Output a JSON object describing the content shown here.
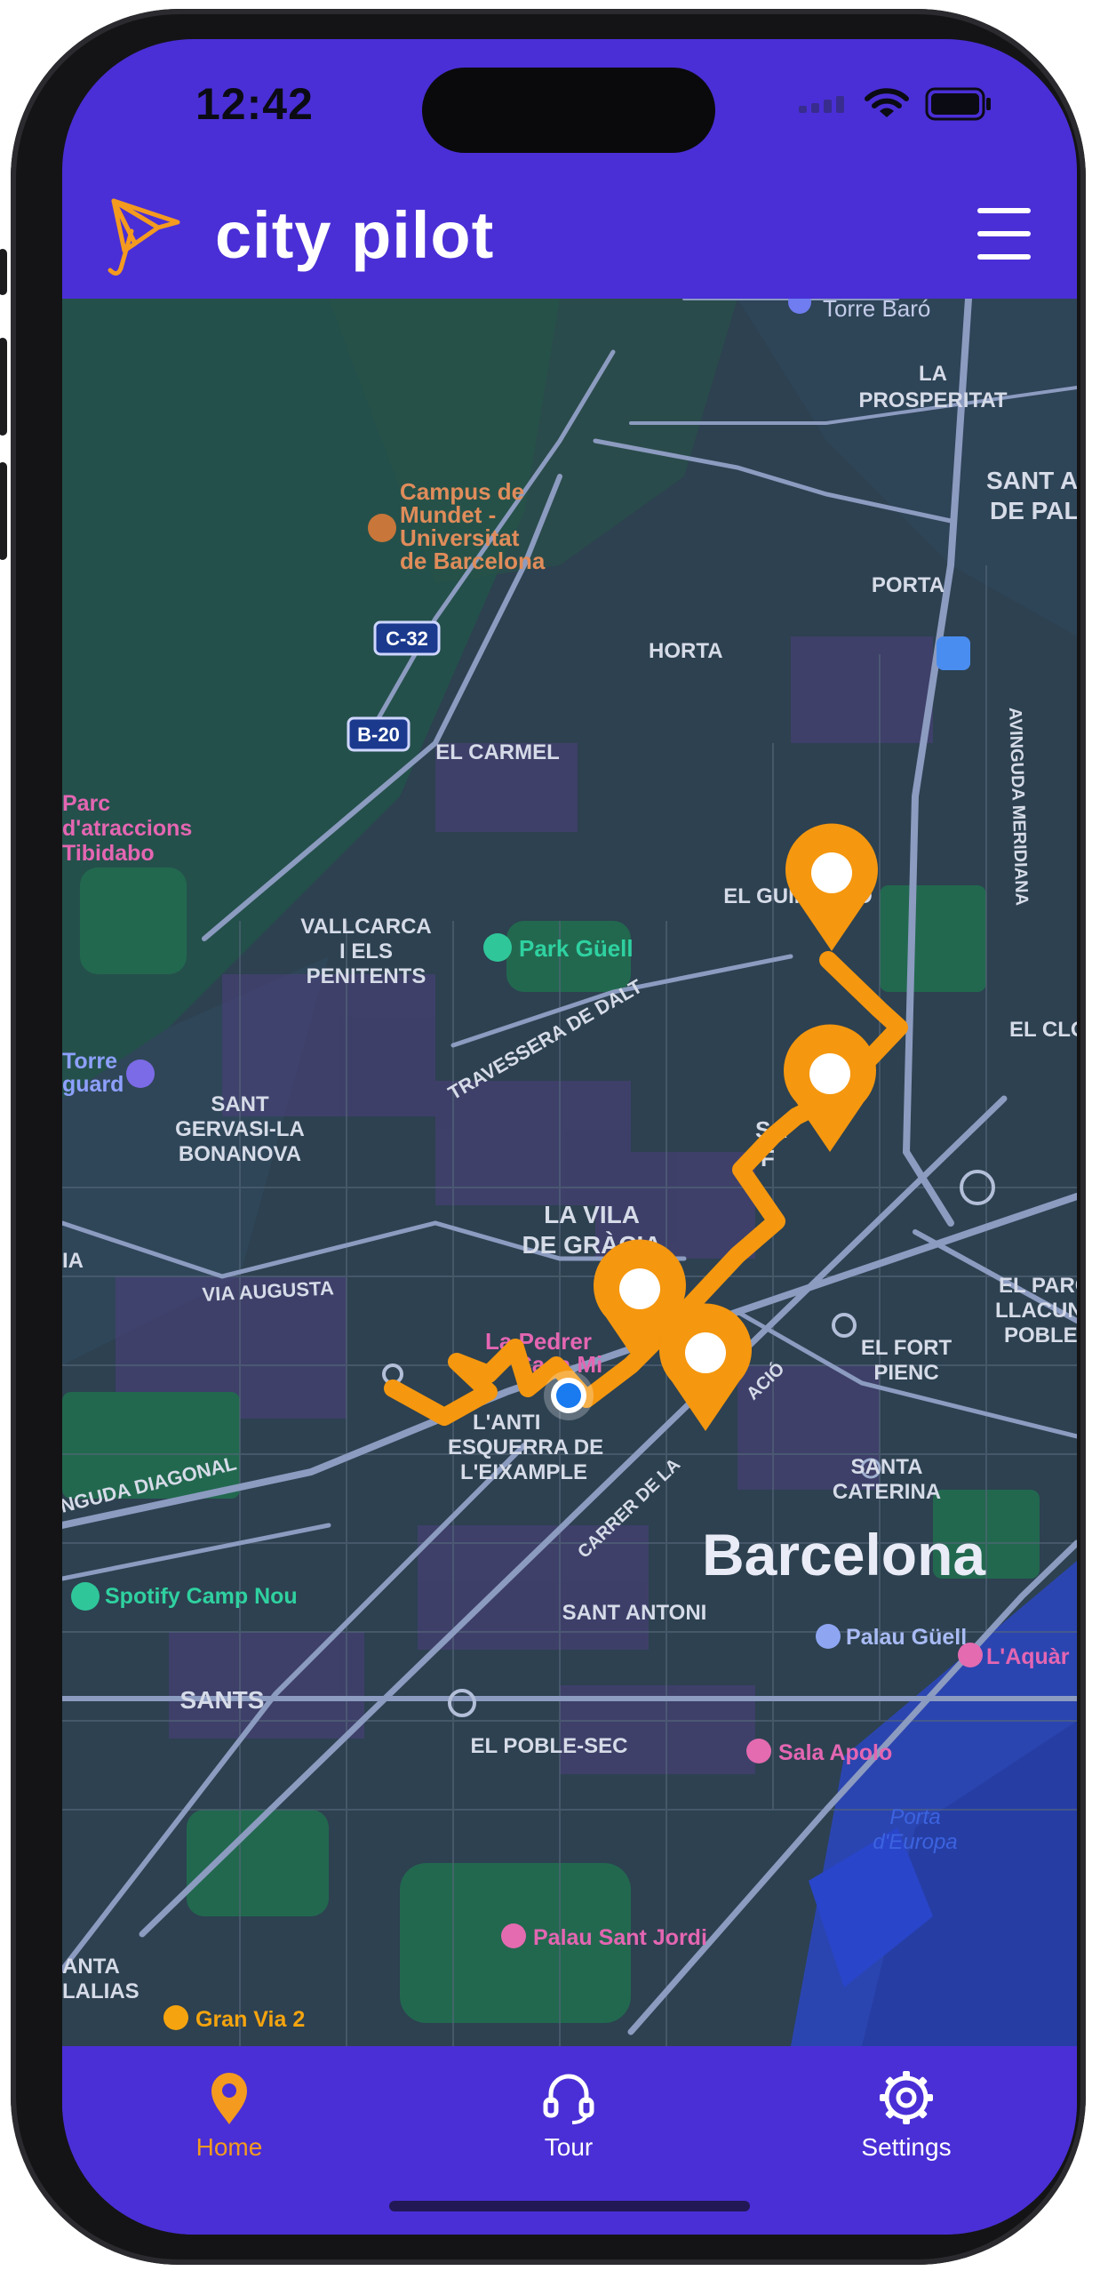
{
  "status_bar": {
    "time": "12:42",
    "icons": [
      "signal-icon",
      "wifi-icon",
      "battery-icon"
    ]
  },
  "header": {
    "title": "city pilot",
    "logo_icon": "umbrella-logo-icon",
    "menu_icon": "hamburger-menu-icon"
  },
  "map": {
    "labels": {
      "torre_baro": "Torre Baró",
      "la_prosperitat": "LA",
      "la_prosperitat2": "PROSPERITAT",
      "sant_andreu": "SANT A",
      "sant_andreu2": "DE PAL",
      "campus1": "Campus de",
      "campus2": "Mundet -",
      "campus3": "Universitat",
      "campus4": "de Barcelona",
      "porta": "PORTA",
      "c32": "C-32",
      "horta": "HORTA",
      "b20": "B-20",
      "el_carmel": "EL CARMEL",
      "parc1": "Parc",
      "parc2": "d'atraccions",
      "parc3": "Tibidabo",
      "el_guinardo": "EL GUINARDÓ",
      "meridiana": "AVINGUDA MERIDIANA",
      "vallcarca1": "VALLCARCA",
      "vallcarca2": "I ELS",
      "vallcarca3": "PENITENTS",
      "park_guell": "Park Güell",
      "el_clot": "EL CLO",
      "travessera": "TRAVESSERA DE DALT",
      "torre1": "Torre",
      "torre2": "guard",
      "sant_gervasi1": "SANT",
      "sant_gervasi2": "GERVASI-LA",
      "sant_gervasi3": "BONANOVA",
      "sagrada1": "SA",
      "sagrada2": "F",
      "vila1": "LA VILA",
      "vila2": "DE GRÀCIA",
      "via_augusta": "VIA AUGUSTA",
      "parc_llacuna1": "EL PARC",
      "parc_llacuna2": "LLACUN",
      "parc_llacuna3": "POBLE",
      "pedrera1": "La Pedrer",
      "pedrera2": "Casa Mi",
      "fort_pienc1": "EL FORT",
      "fort_pienc2": "PIENC",
      "antiga1": "L'ANTI",
      "antiga2": "ESQUERRA DE",
      "antiga3": "L'EIXAMPLE",
      "diagonal": "NGUDA DIAGONAL",
      "carrer": "CARRER DE LA",
      "carrer2": "ACIÓ",
      "santa1": "SANTA",
      "santa2": "CATERINA",
      "barcelona": "Barcelona",
      "camp_nou": "Spotify Camp Nou",
      "sant_antoni": "SANT ANTONI",
      "palau_guell": "Palau Güell",
      "aquarium": "L'Aquàr",
      "sants": "SANTS",
      "sala_apolo": "Sala Apolo",
      "poble_sec": "EL POBLE-SEC",
      "porta_europa1": "Porta",
      "porta_europa2": "d'Europa",
      "palau_jordi": "Palau Sant Jordi",
      "santa_eulalia1": "ANTA",
      "santa_eulalia2": "LALIAS",
      "gran_via": "Gran Via 2",
      "ia": "IA"
    },
    "route_stops": 4,
    "route_color": "#f5970f",
    "user_location_color": "#1a7af0"
  },
  "tabbar": {
    "tabs": [
      {
        "label": "Home",
        "icon": "location-pin-icon",
        "active": true
      },
      {
        "label": "Tour",
        "icon": "headset-icon",
        "active": false
      },
      {
        "label": "Settings",
        "icon": "gear-icon",
        "active": false
      }
    ],
    "active_color": "#f39a1f"
  }
}
